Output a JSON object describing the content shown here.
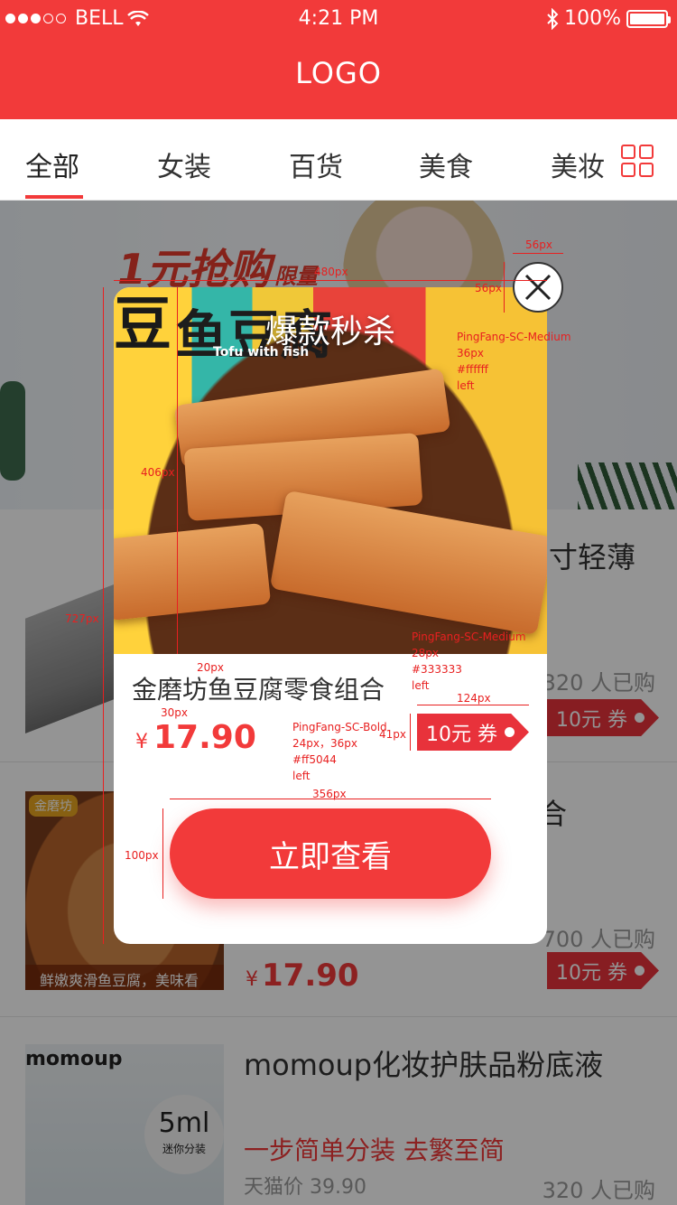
{
  "status_bar": {
    "carrier": "BELL",
    "time": "4:21 PM",
    "battery": "100%",
    "signal_filled": 3,
    "signal_total": 5
  },
  "header": {
    "logo": "LOGO"
  },
  "tabs": [
    "全部",
    "女装",
    "百货",
    "美食",
    "美妆"
  ],
  "banner": {
    "text": "1元抢购",
    "tag": "限量"
  },
  "products": [
    {
      "title": "寸轻薄",
      "sold": "320 人已购",
      "coupon": "10元 券"
    },
    {
      "title": "合",
      "thumb_caption": "鲜嫩爽滑鱼豆腐，美味看得见",
      "thumb_brand": "金磨坊",
      "sold": "700 人已购",
      "currency": "¥",
      "price": "17.90",
      "coupon": "10元 券"
    },
    {
      "title": "momoup化妆护肤品粉底液",
      "thumb_brand": "momoup",
      "thumb_size": "5ml",
      "thumb_size_note": "迷你分装",
      "slogan": "一步简单分装 去繁至简",
      "tmall_price": "天猫价 39.90",
      "sold": "320 人已购"
    }
  ],
  "modal": {
    "heading": "爆款秒杀",
    "hero_pack_text": [
      "豆",
      "鱼豆腐",
      "Tofu with fish"
    ],
    "product_name": "金磨坊鱼豆腐零食组合",
    "currency": "¥",
    "price": "17.90",
    "coupon": "10元 券",
    "cta": "立即查看"
  },
  "annotations": {
    "w480": "480px",
    "w56": "56px",
    "h56": "56px",
    "h406": "406px",
    "h727": "727px",
    "m20": "20px",
    "m30": "30px",
    "h41": "41px",
    "w124": "124px",
    "w356": "356px",
    "h100": "100px",
    "font_heading": [
      "PingFang-SC-Medium",
      "36px",
      "#ffffff",
      "left"
    ],
    "font_name": [
      "PingFang-SC-Medium",
      "28px",
      "#333333",
      "left"
    ],
    "font_price": [
      "PingFang-SC-Bold",
      "24px，36px",
      "#ff5044",
      "left"
    ]
  },
  "colors": {
    "brand_red": "#f23a3a",
    "coupon_red": "#e8323b",
    "annotation_red": "#e82020"
  }
}
